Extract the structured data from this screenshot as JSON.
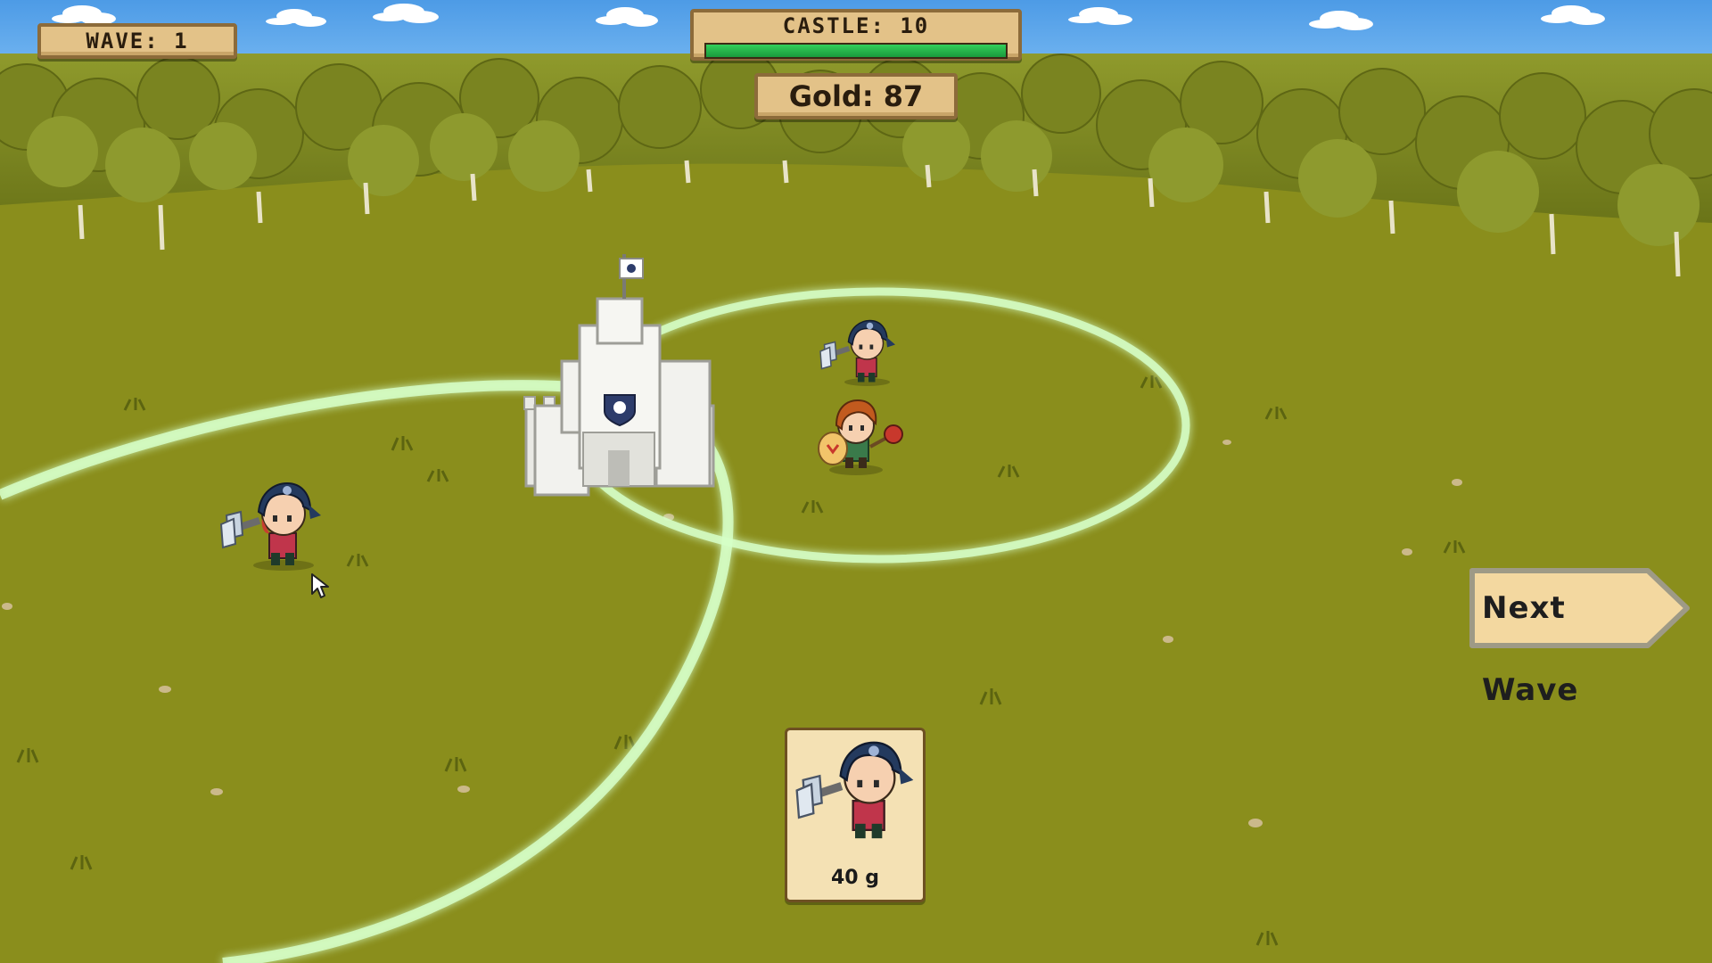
{
  "hud": {
    "wave_label": "WAVE: 1",
    "castle_label": "CASTLE: 10",
    "castle_health_fraction": 1.0,
    "gold_label": "Gold: 87"
  },
  "controls": {
    "next_wave_label": "Next Wave"
  },
  "shop": {
    "units": [
      {
        "name_icon": "axe-warrior-icon",
        "price_label": "40 g"
      }
    ]
  },
  "colors": {
    "grass": "#8a8e1c",
    "forest": "#7f8a22",
    "panel": "#e3c288",
    "panel_border": "#8c6b3a",
    "health_bar": "#2fc255",
    "range_ring": "#d6ffc8"
  }
}
